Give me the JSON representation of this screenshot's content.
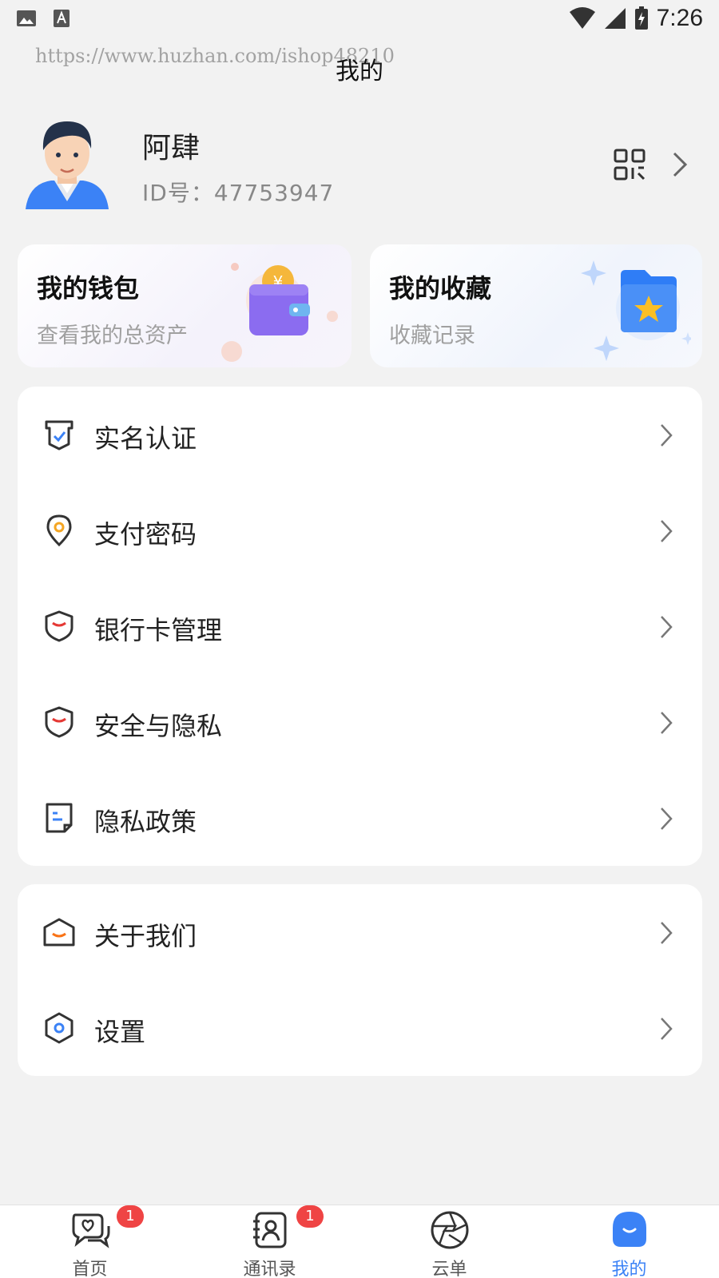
{
  "status_bar": {
    "time": "7:26"
  },
  "watermark": "https://www.huzhan.com/ishop48210",
  "header": {
    "title": "我的"
  },
  "profile": {
    "name": "阿肆",
    "id_text": "ID号：47753947"
  },
  "cards": [
    {
      "title": "我的钱包",
      "subtitle": "查看我的总资产"
    },
    {
      "title": "我的收藏",
      "subtitle": "收藏记录"
    }
  ],
  "menu_group_1": [
    {
      "label": "实名认证",
      "icon": "id-verify-icon"
    },
    {
      "label": "支付密码",
      "icon": "location-pin-icon"
    },
    {
      "label": "银行卡管理",
      "icon": "shield-icon"
    },
    {
      "label": "安全与隐私",
      "icon": "shield-icon"
    },
    {
      "label": "隐私政策",
      "icon": "document-icon"
    }
  ],
  "menu_group_2": [
    {
      "label": "关于我们",
      "icon": "envelope-icon"
    },
    {
      "label": "设置",
      "icon": "hexagon-gear-icon"
    }
  ],
  "tabs": [
    {
      "label": "首页",
      "badge": "1",
      "icon": "home-chat-icon"
    },
    {
      "label": "通讯录",
      "badge": "1",
      "icon": "contacts-icon"
    },
    {
      "label": "云单",
      "badge": "",
      "icon": "aperture-icon"
    },
    {
      "label": "我的",
      "badge": "",
      "icon": "profile-icon",
      "active": true
    }
  ],
  "colors": {
    "accent": "#3b82f6",
    "badge": "#ef4444",
    "icon_accent_red": "#e53935",
    "icon_accent_blue": "#3b82f6"
  }
}
